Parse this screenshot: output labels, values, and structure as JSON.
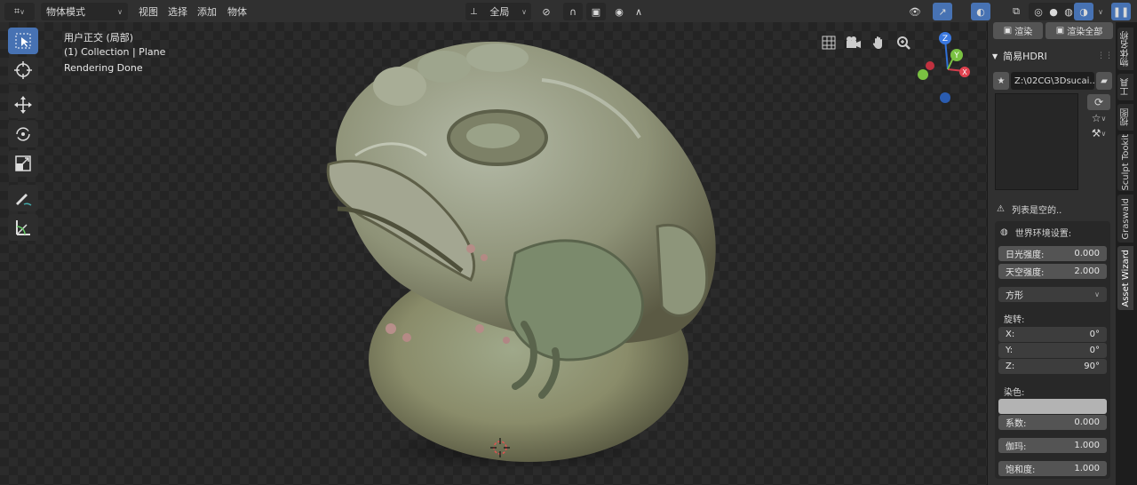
{
  "header": {
    "editor_type_icon": "axes-icon",
    "mode": "物体模式",
    "menu": [
      "视图",
      "选择",
      "添加",
      "物体"
    ],
    "pivot": "全局"
  },
  "viewport": {
    "overlay_lines": [
      "用户正交 (局部)",
      "(1) Collection | Plane",
      "Rendering Done"
    ],
    "gizmo": {
      "z": "Z",
      "y": "Y",
      "x": "X"
    }
  },
  "sidebar": {
    "render_btn": "渲染",
    "render_all_btn": "渲染全部",
    "panel_title": "简易HDRI",
    "path": "Z:\\02CG\\3Dsucai...",
    "empty_list": "列表是空的..",
    "world_settings": "世界环境设置:",
    "sun_strength": {
      "label": "日光强度:",
      "value": "0.000"
    },
    "sky_strength": {
      "label": "天空强度:",
      "value": "2.000"
    },
    "projection": "方形",
    "rotation_label": "旋转:",
    "rot_x": {
      "label": "X:",
      "value": "0°"
    },
    "rot_y": {
      "label": "Y:",
      "value": "0°"
    },
    "rot_z": {
      "label": "Z:",
      "value": "90°"
    },
    "tint_label": "染色:",
    "factor": {
      "label": "系数:",
      "value": "0.000"
    },
    "gamma": {
      "label": "伽玛:",
      "value": "1.000"
    },
    "saturation": {
      "label": "饱和度:",
      "value": "1.000"
    }
  },
  "tabs": [
    "物体名称",
    "工具",
    "视图",
    "Sculpt Tookit",
    "Graswald",
    "Asset Wizard"
  ],
  "colors": {
    "accent": "#4772b3",
    "header": "#303030",
    "panel": "#303030"
  }
}
